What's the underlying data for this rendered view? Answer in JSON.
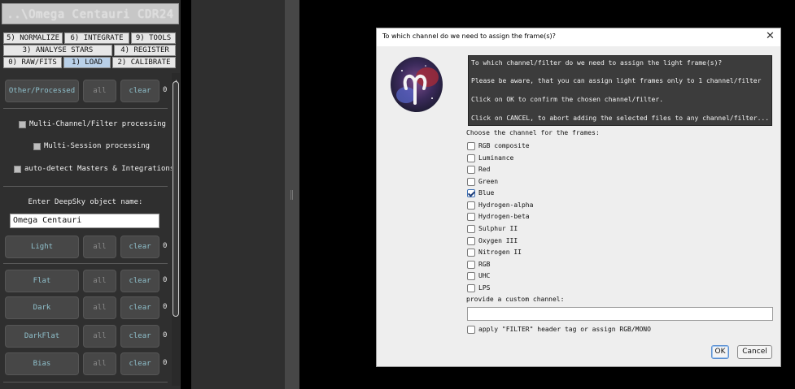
{
  "left_panel": {
    "title": "..\\Omega Centauri CDR24",
    "tabs_row1": [
      "5) NORMALIZE",
      "6) INTEGRATE",
      "9) TOOLS"
    ],
    "tabs_row2": [
      "3) ANALYSE STARS",
      "4) REGISTER"
    ],
    "tabs_row3": [
      "0) RAW/FITS",
      "1) LOAD",
      "2) CALIBRATE"
    ],
    "active_tab": "1) LOAD",
    "other_frames_button": "Other/Processed",
    "all_label": "all",
    "clear_label": "clear",
    "checkboxes": [
      {
        "label": "Multi-Channel/Filter processing",
        "checked": false
      },
      {
        "label": "Multi-Session processing",
        "checked": false
      },
      {
        "label": "auto-detect Masters & Integrations",
        "checked": false
      }
    ],
    "object_name_label": "Enter DeepSky object name:",
    "object_name_value": "Omega Centauri",
    "frame_rows": [
      {
        "label": "Other/Processed",
        "count": "0"
      },
      {
        "label": "Light",
        "count": "0"
      },
      {
        "label": "Flat",
        "count": "0"
      },
      {
        "label": "Dark",
        "count": "0"
      },
      {
        "label": "DarkFlat",
        "count": "0"
      },
      {
        "label": "Bias",
        "count": "0"
      }
    ]
  },
  "dialog": {
    "title": "To which channel do we need to assign the frame(s)?",
    "close_icon": "close-icon",
    "message_lines": [
      "To which channel/filter do we need to assign the light frame(s)?",
      "Please be aware, that you can assign light frames only to 1 channel/filter",
      "Click on OK to confirm the chosen channel/filter.",
      "Click on CANCEL, to abort adding the selected files to any channel/filter..."
    ],
    "choose_label": "Choose the channel for the frames:",
    "channels": [
      {
        "label": "RGB composite",
        "checked": false
      },
      {
        "label": "Luminance",
        "checked": false
      },
      {
        "label": "Red",
        "checked": false
      },
      {
        "label": "Green",
        "checked": false
      },
      {
        "label": "Blue",
        "checked": true
      },
      {
        "label": "Hydrogen-alpha",
        "checked": false
      },
      {
        "label": "Hydrogen-beta",
        "checked": false
      },
      {
        "label": "Sulphur II",
        "checked": false
      },
      {
        "label": "Oxygen III",
        "checked": false
      },
      {
        "label": "Nitrogen II",
        "checked": false
      },
      {
        "label": "RGB",
        "checked": false
      },
      {
        "label": "UHC",
        "checked": false
      },
      {
        "label": "LPS",
        "checked": false
      }
    ],
    "custom_label": "provide a custom channel:",
    "custom_value": "",
    "filter_header_label": "apply \"FILTER\" header tag or assign RGB/MONO",
    "filter_header_checked": false,
    "ok_label": "OK",
    "cancel_label": "Cancel"
  }
}
